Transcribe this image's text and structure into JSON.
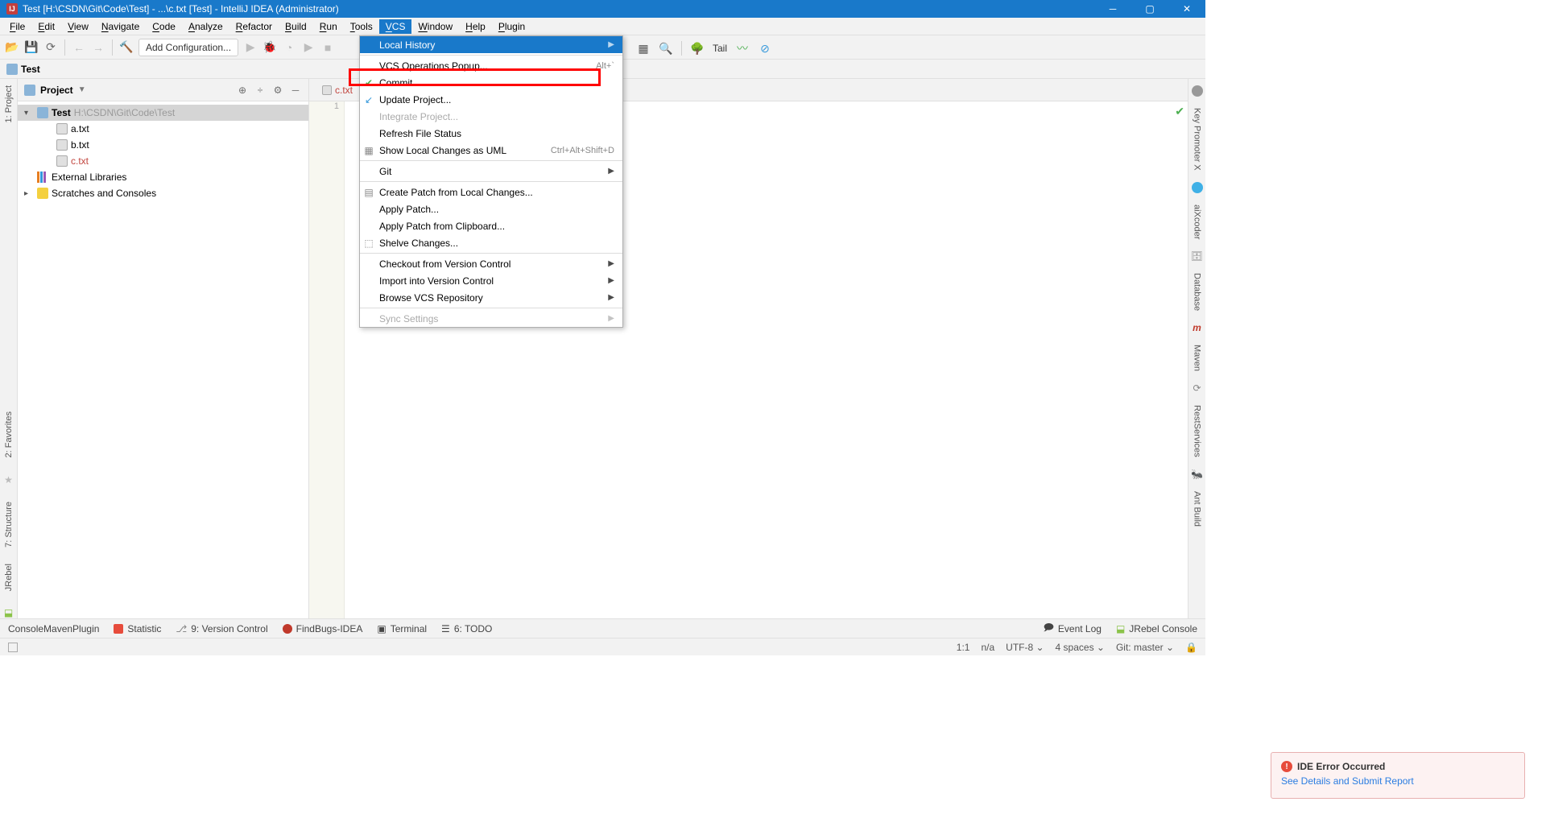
{
  "titlebar": {
    "title": "Test [H:\\CSDN\\Git\\Code\\Test] - ...\\c.txt [Test] - IntelliJ IDEA (Administrator)"
  },
  "menubar": {
    "items": [
      "File",
      "Edit",
      "View",
      "Navigate",
      "Code",
      "Analyze",
      "Refactor",
      "Build",
      "Run",
      "Tools",
      "VCS",
      "Window",
      "Help",
      "Plugin"
    ],
    "active_index": 10
  },
  "toolbar": {
    "add_config": "Add Configuration...",
    "tail": "Tail"
  },
  "breadcrumb": {
    "root": "Test"
  },
  "project_panel": {
    "title": "Project",
    "root": {
      "name": "Test",
      "path": "H:\\CSDN\\Git\\Code\\Test"
    },
    "files": [
      "a.txt",
      "b.txt",
      "c.txt"
    ],
    "external_libs": "External Libraries",
    "scratches": "Scratches and Consoles"
  },
  "editor": {
    "tab": "c.txt",
    "line_number": "1"
  },
  "vcs_menu": {
    "items": [
      {
        "kind": "item",
        "icon": "",
        "label": "Local History",
        "shortcut": "",
        "sub": true,
        "hl": true
      },
      {
        "kind": "sep"
      },
      {
        "kind": "item",
        "icon": "",
        "label": "VCS Operations Popup...",
        "shortcut": "Alt+`"
      },
      {
        "kind": "item",
        "icon": "check",
        "label": "Commit...",
        "shortcut": ""
      },
      {
        "kind": "item",
        "icon": "update",
        "label": "Update Project...",
        "shortcut": ""
      },
      {
        "kind": "item",
        "icon": "",
        "label": "Integrate Project...",
        "shortcut": "",
        "dis": true
      },
      {
        "kind": "item",
        "icon": "",
        "label": "Refresh File Status",
        "shortcut": ""
      },
      {
        "kind": "item",
        "icon": "uml",
        "label": "Show Local Changes as UML",
        "shortcut": "Ctrl+Alt+Shift+D"
      },
      {
        "kind": "sep"
      },
      {
        "kind": "item",
        "icon": "",
        "label": "Git",
        "shortcut": "",
        "sub": true
      },
      {
        "kind": "sep"
      },
      {
        "kind": "item",
        "icon": "patch",
        "label": "Create Patch from Local Changes...",
        "shortcut": ""
      },
      {
        "kind": "item",
        "icon": "",
        "label": "Apply Patch...",
        "shortcut": ""
      },
      {
        "kind": "item",
        "icon": "",
        "label": "Apply Patch from Clipboard...",
        "shortcut": ""
      },
      {
        "kind": "item",
        "icon": "shelve",
        "label": "Shelve Changes...",
        "shortcut": ""
      },
      {
        "kind": "sep"
      },
      {
        "kind": "item",
        "icon": "",
        "label": "Checkout from Version Control",
        "shortcut": "",
        "sub": true
      },
      {
        "kind": "item",
        "icon": "",
        "label": "Import into Version Control",
        "shortcut": "",
        "sub": true
      },
      {
        "kind": "item",
        "icon": "",
        "label": "Browse VCS Repository",
        "shortcut": "",
        "sub": true
      },
      {
        "kind": "sep"
      },
      {
        "kind": "item",
        "icon": "",
        "label": "Sync Settings",
        "shortcut": "",
        "sub": true,
        "dis": true
      }
    ]
  },
  "left_tools": [
    "1: Project",
    "2: Favorites",
    "7: Structure",
    "JRebel"
  ],
  "right_tools": [
    "Key Promoter X",
    "aiXcoder",
    "Database",
    "Maven",
    "RestServices",
    "Ant Build"
  ],
  "notification": {
    "title": "IDE Error Occurred",
    "link": "See Details and Submit Report"
  },
  "bottom_bar": {
    "items": [
      "ConsoleMavenPlugin",
      "Statistic",
      "9: Version Control",
      "FindBugs-IDEA",
      "Terminal",
      "6: TODO"
    ],
    "event_log": "Event Log",
    "jrebel": "JRebel Console"
  },
  "status_bar": {
    "pos": "1:1",
    "na": "n/a",
    "encoding": "UTF-8",
    "indent": "4 spaces",
    "git": "Git: master"
  }
}
